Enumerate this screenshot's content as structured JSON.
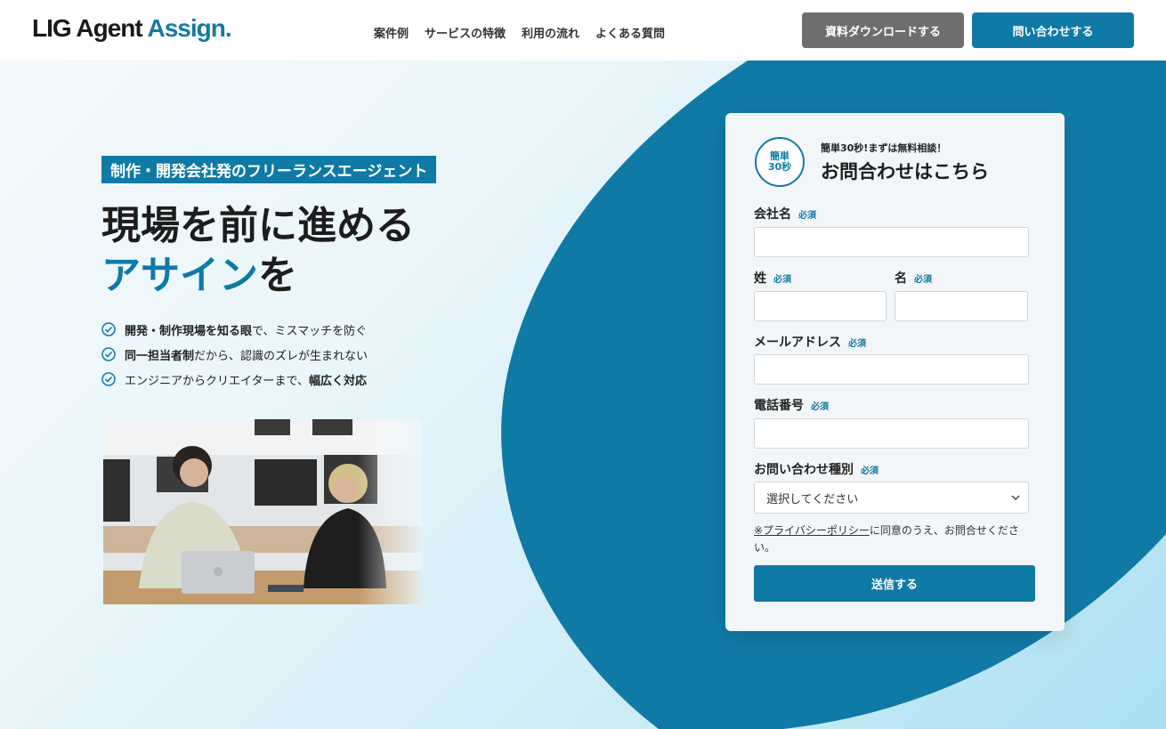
{
  "colors": {
    "accent": "#107aa6",
    "secondary_button": "#6e6e6e"
  },
  "header": {
    "logo_part1": "LIG Agent ",
    "logo_part2": "Assign.",
    "nav": [
      "案件例",
      "サービスの特徴",
      "利用の流れ",
      "よくある質問"
    ],
    "download_button": "資料ダウンロードする",
    "contact_button": "問い合わせする"
  },
  "hero": {
    "tag": "制作・開発会社発のフリーランスエージェント",
    "headline_line1": "現場を前に進める",
    "headline_accent": "アサイン",
    "headline_suffix": "を",
    "features": [
      {
        "bold": "開発・制作現場を知る眼",
        "rest": "で、ミスマッチを防ぐ",
        "icon": "check-circle-icon"
      },
      {
        "bold": "同一担当者制",
        "rest": "だから、認識のズレが生まれない",
        "icon": "check-circle-icon"
      },
      {
        "pre": "エンジニアからクリエイターまで、",
        "bold": "幅広く対応",
        "icon": "check-circle-icon"
      }
    ]
  },
  "form": {
    "badge_line1": "簡単",
    "badge_line2": "30秒",
    "subtitle": "簡単30秒!まずは無料相談！",
    "title": "お問合わせはこちら",
    "required": "必須",
    "company_label": "会社名",
    "last_name_label": "姓",
    "first_name_label": "名",
    "email_label": "メールアドレス",
    "phone_label": "電話番号",
    "inquiry_type_label": "お問い合わせ種別",
    "inquiry_type_selected": "選択してください",
    "privacy_link": "※プライバシーポリシー",
    "privacy_text": "に同意のうえ、お問合せください。",
    "submit": "送信する"
  }
}
